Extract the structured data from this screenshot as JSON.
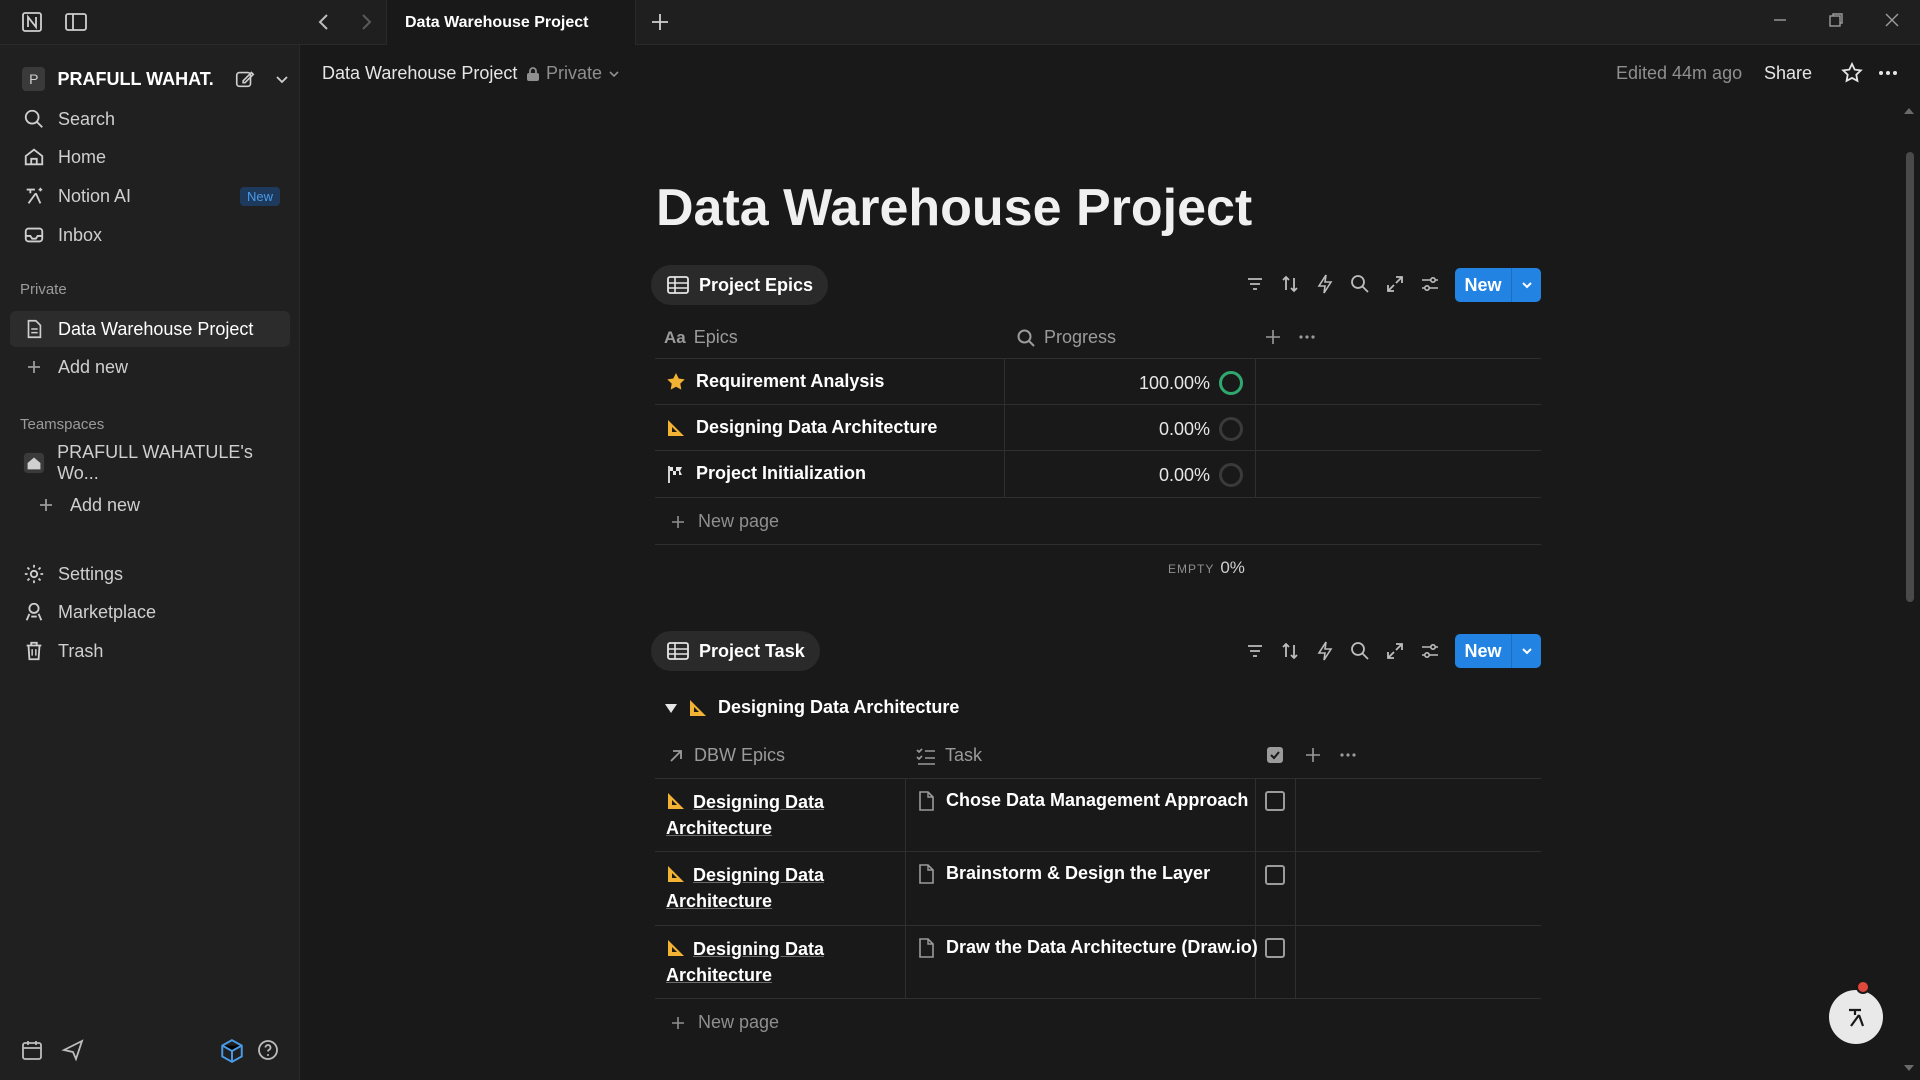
{
  "titlebar": {
    "tab_title": "Data Warehouse Project"
  },
  "sidebar": {
    "workspace_initial": "P",
    "workspace_name": "PRAFULL WAHAT...",
    "nav": [
      {
        "label": "Search",
        "icon": "search-icon"
      },
      {
        "label": "Home",
        "icon": "home-icon"
      },
      {
        "label": "Notion AI",
        "icon": "notion-ai-icon",
        "badge": "New"
      },
      {
        "label": "Inbox",
        "icon": "inbox-icon"
      }
    ],
    "private_heading": "Private",
    "private_page": "Data Warehouse Project",
    "add_new": "Add new",
    "teamspaces_heading": "Teamspaces",
    "teamspace_name": "PRAFULL WAHATULE's Wo...",
    "teamspace_add_new": "Add new",
    "bottom_nav": [
      {
        "label": "Settings",
        "icon": "settings-icon"
      },
      {
        "label": "Marketplace",
        "icon": "marketplace-icon"
      },
      {
        "label": "Trash",
        "icon": "trash-icon"
      }
    ]
  },
  "topbar": {
    "breadcrumb": "Data Warehouse Project",
    "privacy": "Private",
    "edited": "Edited 44m ago",
    "share": "Share"
  },
  "page": {
    "title": "Data Warehouse Project"
  },
  "epics_db": {
    "title": "Project Epics",
    "new_button": "New",
    "columns": {
      "name": "Epics",
      "progress": "Progress"
    },
    "rows": [
      {
        "name": "Requirement Analysis",
        "icon": "star-icon",
        "progress": "100.00%",
        "progress_value": 1.0
      },
      {
        "name": "Designing Data Architecture",
        "icon": "triangle-ruler-icon",
        "progress": "0.00%",
        "progress_value": 0.0
      },
      {
        "name": "Project Initialization",
        "icon": "checkered-flag-icon",
        "progress": "0.00%",
        "progress_value": 0.0
      }
    ],
    "new_page": "New page",
    "footer_label": "EMPTY",
    "footer_value": "0%"
  },
  "tasks_db": {
    "title": "Project Task",
    "new_button": "New",
    "group_label": "Designing Data Architecture",
    "columns": {
      "epic": "DBW Epics",
      "task": "Task"
    },
    "rows": [
      {
        "epic_line1": "Designing Data",
        "epic_line2": "Architecture",
        "task": "Chose Data Management Approach",
        "done": false
      },
      {
        "epic_line1": "Designing Data",
        "epic_line2": "Architecture",
        "task": "Brainstorm & Design the Layer",
        "done": false
      },
      {
        "epic_line1": "Designing Data",
        "epic_line2": "Architecture",
        "task": "Draw the Data Architecture (Draw.io)",
        "done": false
      }
    ],
    "new_page": "New page"
  },
  "colors": {
    "accent": "#2383e2",
    "progress_complete": "#2ea86e",
    "background": "#191919",
    "sidebar": "#202020"
  }
}
